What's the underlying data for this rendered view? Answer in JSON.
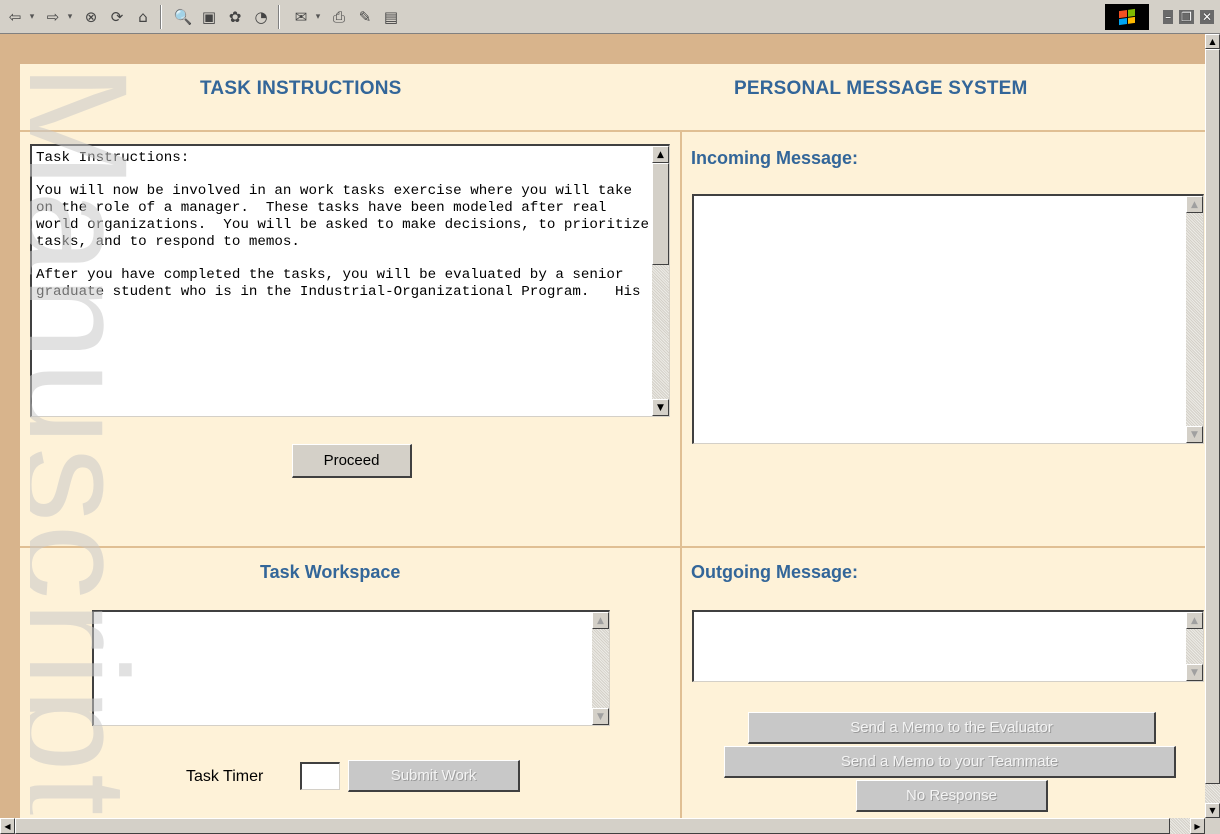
{
  "toolbar": {
    "icons": [
      "back-icon",
      "forward-icon",
      "stop-icon",
      "refresh-icon",
      "home-icon",
      "search-icon",
      "favorites-icon",
      "media-icon",
      "history-icon",
      "mail-icon",
      "print-icon",
      "edit-icon",
      "discuss-icon"
    ],
    "glyphs": {
      "back": "⇦",
      "back_drop": "▾",
      "forward": "⇨",
      "forward_drop": "▾",
      "stop": "⊗",
      "refresh": "⟳",
      "home": "⌂",
      "search": "🔍",
      "favorites": "▣",
      "media": "✿",
      "history": "◔",
      "mail": "✉",
      "mail_drop": "▾",
      "print": "⎙",
      "edit": "✎",
      "discuss": "▤"
    },
    "window_controls": {
      "minimize": "–",
      "restore": "❐",
      "close": "✕"
    }
  },
  "headers": {
    "task_instructions": "TASK INSTRUCTIONS",
    "personal_message_system": "PERSONAL MESSAGE SYSTEM"
  },
  "instructions": {
    "text": "Task Instructions:\n\nYou will now be involved in an work tasks exercise where you will take on the role of a manager.  These tasks have been modeled after real world organizations.  You will be asked to make decisions, to prioritize tasks, and to respond to memos.\n\nAfter you have completed the tasks, you will be evaluated by a senior graduate student who is in the Industrial-Organizational Program.   His"
  },
  "proceed_button": "Proceed",
  "incoming": {
    "label": "Incoming Message:",
    "value": ""
  },
  "workspace": {
    "label": "Task Workspace",
    "value": ""
  },
  "outgoing": {
    "label": "Outgoing Message:",
    "value": ""
  },
  "timer": {
    "label": "Task Timer",
    "value": ""
  },
  "buttons": {
    "submit_work": "Submit Work",
    "send_evaluator": "Send a Memo to the Evaluator",
    "send_teammate": "Send a Memo to your Teammate",
    "no_response": "No Response"
  },
  "watermark": "Manuscript",
  "colors": {
    "header": "#336699",
    "panel": "#fef2d8",
    "border": "#d8b48c"
  }
}
